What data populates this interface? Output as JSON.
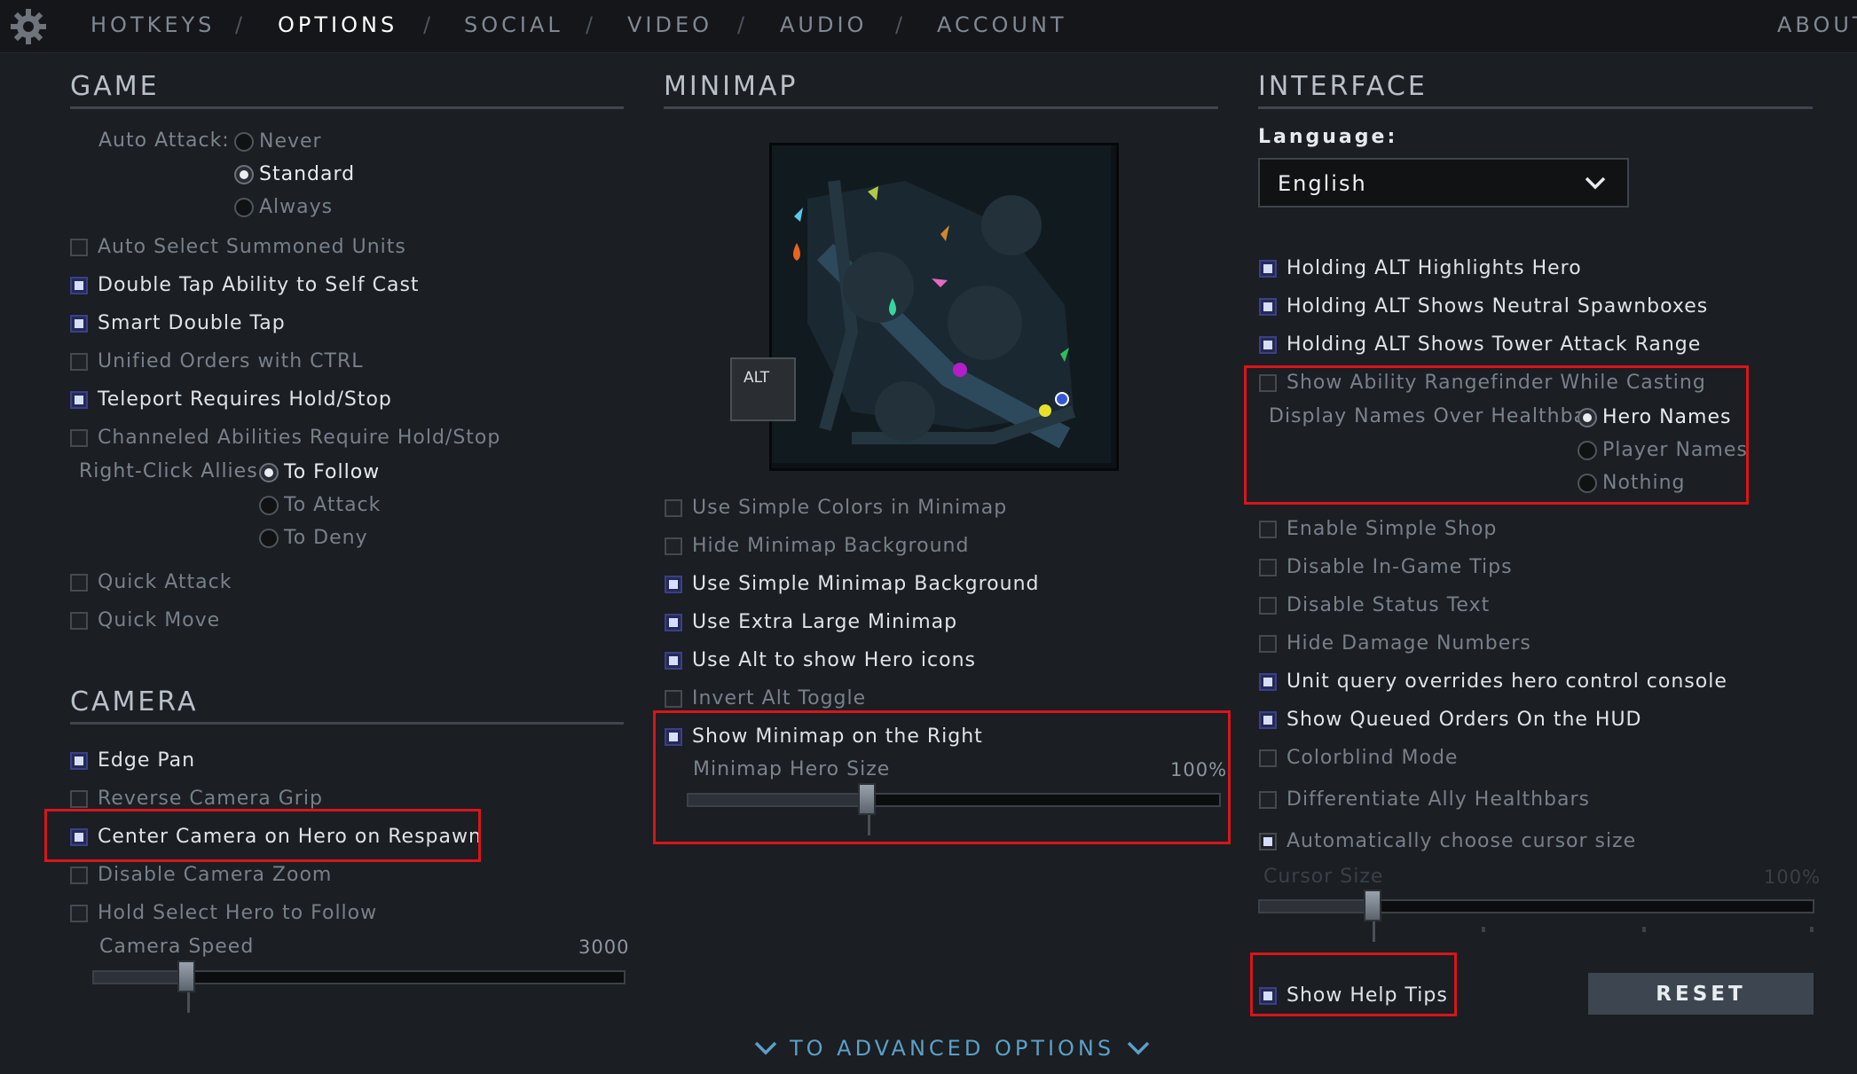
{
  "colors": {
    "accent_blue": "#5aa0c8",
    "highlight_red": "#d8151a",
    "background": "#1b1e22"
  },
  "nav": {
    "tabs": [
      "HOTKEYS",
      "OPTIONS",
      "SOCIAL",
      "VIDEO",
      "AUDIO",
      "ACCOUNT"
    ],
    "active_tab": "OPTIONS",
    "separator": "/",
    "about": "ABOUT",
    "settings_icon": "gear-icon"
  },
  "game": {
    "title": "GAME",
    "auto_attack_label": "Auto Attack:",
    "auto_attack_options": [
      "Never",
      "Standard",
      "Always"
    ],
    "auto_attack_selected": "Standard",
    "options": [
      {
        "label": "Auto Select Summoned Units",
        "checked": false
      },
      {
        "label": "Double Tap Ability to Self Cast",
        "checked": true
      },
      {
        "label": "Smart Double Tap",
        "checked": true
      },
      {
        "label": "Unified Orders with CTRL",
        "checked": false
      },
      {
        "label": "Teleport Requires Hold/Stop",
        "checked": true
      },
      {
        "label": "Channeled Abilities Require Hold/Stop",
        "checked": false
      }
    ],
    "right_click_label": "Right-Click Allies",
    "right_click_options": [
      "To Follow",
      "To Attack",
      "To Deny"
    ],
    "right_click_selected": "To Follow",
    "options2": [
      {
        "label": "Quick Attack",
        "checked": false
      },
      {
        "label": "Quick Move",
        "checked": false
      }
    ]
  },
  "camera": {
    "title": "CAMERA",
    "options": [
      {
        "label": "Edge Pan",
        "checked": true
      },
      {
        "label": "Reverse Camera Grip",
        "checked": false
      },
      {
        "label": "Center Camera on Hero on Respawn",
        "checked": true
      },
      {
        "label": "Disable Camera Zoom",
        "checked": false
      },
      {
        "label": "Hold Select Hero to Follow",
        "checked": false
      }
    ],
    "speed_label": "Camera Speed",
    "speed_value": "3000",
    "speed_level": 0.18
  },
  "minimap": {
    "title": "MINIMAP",
    "alt_label": "ALT",
    "options": [
      {
        "label": "Use Simple Colors in Minimap",
        "checked": false
      },
      {
        "label": "Hide Minimap Background",
        "checked": false
      },
      {
        "label": "Use Simple Minimap Background",
        "checked": true
      },
      {
        "label": "Use Extra Large Minimap",
        "checked": true
      },
      {
        "label": "Use Alt to show Hero icons",
        "checked": true
      },
      {
        "label": "Invert Alt Toggle",
        "checked": false
      },
      {
        "label": "Show Minimap on the Right",
        "checked": true
      }
    ],
    "hero_size_label": "Minimap Hero Size",
    "hero_size_value": "100%",
    "hero_size_level": 0.34
  },
  "interface": {
    "title": "INTERFACE",
    "language_label": "Language:",
    "language_value": "English",
    "options": [
      {
        "label": "Holding ALT Highlights Hero",
        "checked": true
      },
      {
        "label": "Holding ALT Shows Neutral Spawnboxes",
        "checked": true
      },
      {
        "label": "Holding ALT Shows Tower Attack Range",
        "checked": true
      },
      {
        "label": "Show Ability Rangefinder While Casting",
        "checked": false
      }
    ],
    "names_label": "Display Names Over Healthbar",
    "names_options": [
      "Hero Names",
      "Player Names",
      "Nothing"
    ],
    "names_selected": "Hero Names",
    "options2": [
      {
        "label": "Enable Simple Shop",
        "checked": false
      },
      {
        "label": "Disable In-Game Tips",
        "checked": false
      },
      {
        "label": "Disable Status Text",
        "checked": false
      },
      {
        "label": "Hide Damage Numbers",
        "checked": false
      },
      {
        "label": "Unit query overrides hero control console",
        "checked": true
      },
      {
        "label": "Show Queued Orders On the HUD",
        "checked": true
      },
      {
        "label": "Colorblind Mode",
        "checked": false
      },
      {
        "label": "Differentiate Ally Healthbars",
        "checked": false
      },
      {
        "label": "Automatically choose cursor size",
        "checked": true
      }
    ],
    "cursor_size_label": "Cursor Size",
    "cursor_size_value": "100%",
    "cursor_size_level": 0.2,
    "help_tips": {
      "label": "Show Help Tips",
      "checked": true
    },
    "reset_label": "RESET"
  },
  "footer": {
    "advanced_label": "TO ADVANCED OPTIONS"
  }
}
